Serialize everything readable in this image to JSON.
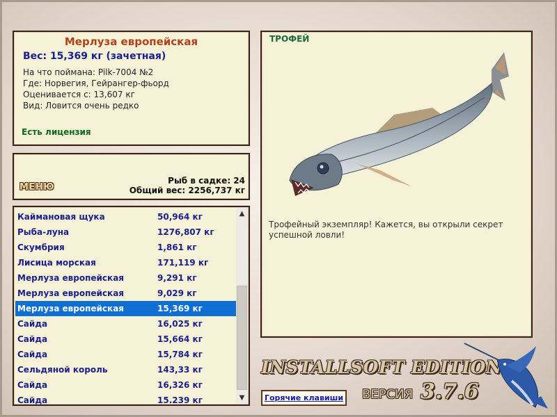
{
  "info": {
    "fish_name": "Мерлуза европейская",
    "weight": "Вес: 15,369 кг (зачетная)",
    "caught_on": "На что поймана: Pilk-7004 №2",
    "location": "Где: Норвегия, Гейрангер-фьорд",
    "valued_from": "Оценивается с: 13,607 кг",
    "kind": "Вид: Ловится очень редко",
    "license": "Есть лицензия"
  },
  "keeper": {
    "menu_label": "МЕНЮ",
    "fish_count": "Рыб в садке: 24",
    "total_weight": "Общий вес: 2256,737 кг"
  },
  "catch_list": [
    {
      "name": "Каймановая щука",
      "weight": "50,964 кг",
      "selected": false
    },
    {
      "name": "Рыба-луна",
      "weight": "1276,807 кг",
      "selected": false
    },
    {
      "name": "Скумбрия",
      "weight": "1,861 кг",
      "selected": false
    },
    {
      "name": "Лисица морская",
      "weight": "171,119 кг",
      "selected": false
    },
    {
      "name": "Мерлуза европейская",
      "weight": "9,291 кг",
      "selected": false
    },
    {
      "name": "Мерлуза европейская",
      "weight": "9,029 кг",
      "selected": false
    },
    {
      "name": "Мерлуза европейская",
      "weight": "15,369 кг",
      "selected": true
    },
    {
      "name": "Сайда",
      "weight": "16,025 кг",
      "selected": false
    },
    {
      "name": "Сайда",
      "weight": "15,664 кг",
      "selected": false
    },
    {
      "name": "Сайда",
      "weight": "15,784 кг",
      "selected": false
    },
    {
      "name": "Сельдяной король",
      "weight": "143,33 кг",
      "selected": false
    },
    {
      "name": "Сайда",
      "weight": "16,326 кг",
      "selected": false
    },
    {
      "name": "Сайда",
      "weight": "15.239 кг",
      "selected": false
    }
  ],
  "trophy": {
    "title": "ТРОФЕЙ",
    "description": "Трофейный экземпляр! Кажется, вы открыли секрет успешной ловли!"
  },
  "brand": {
    "edition": "INSTALLSOFT EDITION",
    "version_label": "ВЕРСИЯ",
    "version_number": "3.7.6"
  },
  "hotkeys_label": "Горячие клавиши",
  "colors": {
    "panel_bg": "#f5f2d8",
    "panel_border": "#3b2216",
    "fish_name": "#b2421c",
    "weight_text": "#1a2090",
    "license": "#0a6a1c",
    "list_text": "#1a1f8a",
    "selection": "#0f6fd3"
  }
}
